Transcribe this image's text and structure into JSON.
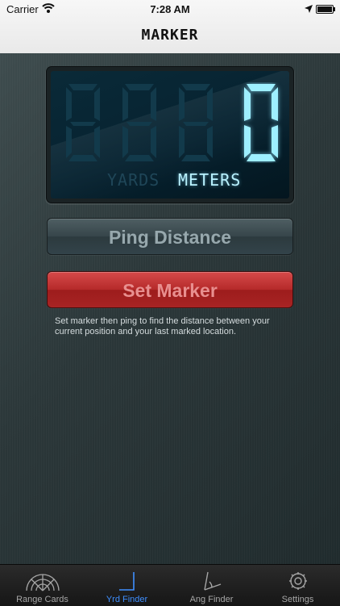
{
  "status_bar": {
    "carrier": "Carrier",
    "time": "7:28 AM"
  },
  "nav": {
    "title": "MARKER"
  },
  "display": {
    "value": "0",
    "ghost_digits": "888",
    "units": {
      "yards": "YARDS",
      "meters": "METERS",
      "active": "meters"
    },
    "colors": {
      "lit": "#9eefff",
      "ghost": "#123a4b"
    }
  },
  "buttons": {
    "ping": "Ping Distance",
    "set_marker": "Set Marker"
  },
  "help_text": "Set marker then ping to find the distance between your current position and your last marked location.",
  "tabs": [
    {
      "label": "Range Cards",
      "icon": "range-cards-icon",
      "active": false
    },
    {
      "label": "Yrd Finder",
      "icon": "yard-finder-icon",
      "active": true
    },
    {
      "label": "Ang Finder",
      "icon": "angle-finder-icon",
      "active": false
    },
    {
      "label": "Settings",
      "icon": "gear-icon",
      "active": false
    }
  ],
  "accent_color": "#3f8fff"
}
